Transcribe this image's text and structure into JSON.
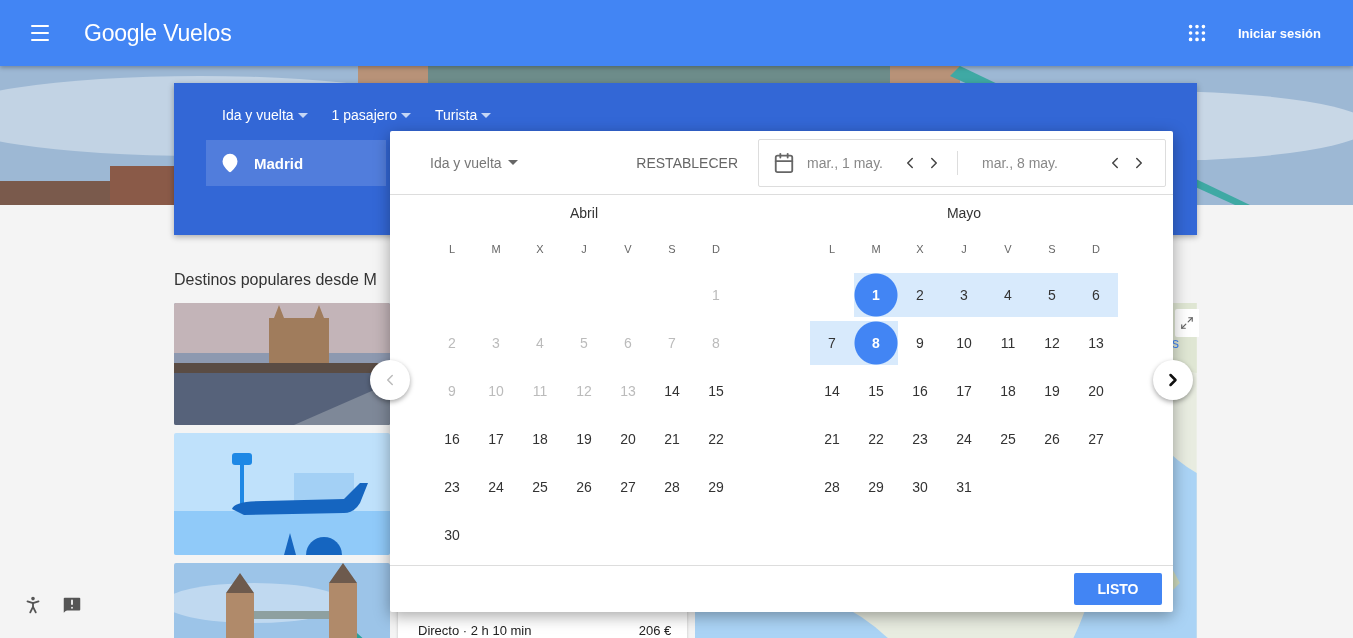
{
  "header": {
    "title": "Google Vuelos",
    "sign_in": "Iniciar sesión"
  },
  "search": {
    "trip_type": "Ida y vuelta",
    "passengers": "1 pasajero",
    "cabin": "Turista",
    "origin": "Madrid"
  },
  "popular": {
    "heading": "Destinos populares desde M",
    "link_fragment": "s",
    "cards": [
      {
        "kind": "picture"
      },
      {
        "kind": "illustration"
      },
      {
        "kind": "picture"
      }
    ],
    "result": {
      "stops": "Directo · 2 h 10 min",
      "price": "206 €"
    }
  },
  "date_picker": {
    "trip_type": "Ida y vuelta",
    "reset": "RESTABLECER",
    "departure": "mar., 1 may.",
    "return": "mar., 8 may.",
    "done": "LISTO",
    "prev_month": {
      "disabled": true
    },
    "next_month": {
      "disabled": false
    },
    "months": [
      {
        "name": "Abril",
        "weekdays": [
          "L",
          "M",
          "X",
          "J",
          "V",
          "S",
          "D"
        ],
        "weeks": [
          [
            {
              "kind": "blank"
            },
            {
              "kind": "blank"
            },
            {
              "kind": "blank"
            },
            {
              "kind": "blank"
            },
            {
              "kind": "blank"
            },
            {
              "kind": "blank"
            },
            {
              "kind": "day",
              "label": "1",
              "disabled": true,
              "selected": false,
              "in_range": false
            }
          ],
          [
            {
              "kind": "day",
              "label": "2",
              "disabled": true,
              "selected": false,
              "in_range": false
            },
            {
              "kind": "day",
              "label": "3",
              "disabled": true,
              "selected": false,
              "in_range": false
            },
            {
              "kind": "day",
              "label": "4",
              "disabled": true,
              "selected": false,
              "in_range": false
            },
            {
              "kind": "day",
              "label": "5",
              "disabled": true,
              "selected": false,
              "in_range": false
            },
            {
              "kind": "day",
              "label": "6",
              "disabled": true,
              "selected": false,
              "in_range": false
            },
            {
              "kind": "day",
              "label": "7",
              "disabled": true,
              "selected": false,
              "in_range": false
            },
            {
              "kind": "day",
              "label": "8",
              "disabled": true,
              "selected": false,
              "in_range": false
            }
          ],
          [
            {
              "kind": "day",
              "label": "9",
              "disabled": true,
              "selected": false,
              "in_range": false
            },
            {
              "kind": "day",
              "label": "10",
              "disabled": true,
              "selected": false,
              "in_range": false
            },
            {
              "kind": "day",
              "label": "11",
              "disabled": true,
              "selected": false,
              "in_range": false
            },
            {
              "kind": "day",
              "label": "12",
              "disabled": true,
              "selected": false,
              "in_range": false
            },
            {
              "kind": "day",
              "label": "13",
              "disabled": true,
              "selected": false,
              "in_range": false
            },
            {
              "kind": "day",
              "label": "14",
              "disabled": false,
              "selected": false,
              "in_range": false
            },
            {
              "kind": "day",
              "label": "15",
              "disabled": false,
              "selected": false,
              "in_range": false
            }
          ],
          [
            {
              "kind": "day",
              "label": "16",
              "disabled": false,
              "selected": false,
              "in_range": false
            },
            {
              "kind": "day",
              "label": "17",
              "disabled": false,
              "selected": false,
              "in_range": false
            },
            {
              "kind": "day",
              "label": "18",
              "disabled": false,
              "selected": false,
              "in_range": false
            },
            {
              "kind": "day",
              "label": "19",
              "disabled": false,
              "selected": false,
              "in_range": false
            },
            {
              "kind": "day",
              "label": "20",
              "disabled": false,
              "selected": false,
              "in_range": false
            },
            {
              "kind": "day",
              "label": "21",
              "disabled": false,
              "selected": false,
              "in_range": false
            },
            {
              "kind": "day",
              "label": "22",
              "disabled": false,
              "selected": false,
              "in_range": false
            }
          ],
          [
            {
              "kind": "day",
              "label": "23",
              "disabled": false,
              "selected": false,
              "in_range": false
            },
            {
              "kind": "day",
              "label": "24",
              "disabled": false,
              "selected": false,
              "in_range": false
            },
            {
              "kind": "day",
              "label": "25",
              "disabled": false,
              "selected": false,
              "in_range": false
            },
            {
              "kind": "day",
              "label": "26",
              "disabled": false,
              "selected": false,
              "in_range": false
            },
            {
              "kind": "day",
              "label": "27",
              "disabled": false,
              "selected": false,
              "in_range": false
            },
            {
              "kind": "day",
              "label": "28",
              "disabled": false,
              "selected": false,
              "in_range": false
            },
            {
              "kind": "day",
              "label": "29",
              "disabled": false,
              "selected": false,
              "in_range": false
            }
          ],
          [
            {
              "kind": "day",
              "label": "30",
              "disabled": false,
              "selected": false,
              "in_range": false
            }
          ]
        ]
      },
      {
        "name": "Mayo",
        "weekdays": [
          "L",
          "M",
          "X",
          "J",
          "V",
          "S",
          "D"
        ],
        "weeks": [
          [
            {
              "kind": "blank"
            },
            {
              "kind": "day",
              "label": "1",
              "disabled": false,
              "selected": true,
              "in_range": true
            },
            {
              "kind": "day",
              "label": "2",
              "disabled": false,
              "selected": false,
              "in_range": true
            },
            {
              "kind": "day",
              "label": "3",
              "disabled": false,
              "selected": false,
              "in_range": true
            },
            {
              "kind": "day",
              "label": "4",
              "disabled": false,
              "selected": false,
              "in_range": true
            },
            {
              "kind": "day",
              "label": "5",
              "disabled": false,
              "selected": false,
              "in_range": true
            },
            {
              "kind": "day",
              "label": "6",
              "disabled": false,
              "selected": false,
              "in_range": true
            }
          ],
          [
            {
              "kind": "day",
              "label": "7",
              "disabled": false,
              "selected": false,
              "in_range": true
            },
            {
              "kind": "day",
              "label": "8",
              "disabled": false,
              "selected": true,
              "in_range": true
            },
            {
              "kind": "day",
              "label": "9",
              "disabled": false,
              "selected": false,
              "in_range": false
            },
            {
              "kind": "day",
              "label": "10",
              "disabled": false,
              "selected": false,
              "in_range": false
            },
            {
              "kind": "day",
              "label": "11",
              "disabled": false,
              "selected": false,
              "in_range": false
            },
            {
              "kind": "day",
              "label": "12",
              "disabled": false,
              "selected": false,
              "in_range": false
            },
            {
              "kind": "day",
              "label": "13",
              "disabled": false,
              "selected": false,
              "in_range": false
            }
          ],
          [
            {
              "kind": "day",
              "label": "14",
              "disabled": false,
              "selected": false,
              "in_range": false
            },
            {
              "kind": "day",
              "label": "15",
              "disabled": false,
              "selected": false,
              "in_range": false
            },
            {
              "kind": "day",
              "label": "16",
              "disabled": false,
              "selected": false,
              "in_range": false
            },
            {
              "kind": "day",
              "label": "17",
              "disabled": false,
              "selected": false,
              "in_range": false
            },
            {
              "kind": "day",
              "label": "18",
              "disabled": false,
              "selected": false,
              "in_range": false
            },
            {
              "kind": "day",
              "label": "19",
              "disabled": false,
              "selected": false,
              "in_range": false
            },
            {
              "kind": "day",
              "label": "20",
              "disabled": false,
              "selected": false,
              "in_range": false
            }
          ],
          [
            {
              "kind": "day",
              "label": "21",
              "disabled": false,
              "selected": false,
              "in_range": false
            },
            {
              "kind": "day",
              "label": "22",
              "disabled": false,
              "selected": false,
              "in_range": false
            },
            {
              "kind": "day",
              "label": "23",
              "disabled": false,
              "selected": false,
              "in_range": false
            },
            {
              "kind": "day",
              "label": "24",
              "disabled": false,
              "selected": false,
              "in_range": false
            },
            {
              "kind": "day",
              "label": "25",
              "disabled": false,
              "selected": false,
              "in_range": false
            },
            {
              "kind": "day",
              "label": "26",
              "disabled": false,
              "selected": false,
              "in_range": false
            },
            {
              "kind": "day",
              "label": "27",
              "disabled": false,
              "selected": false,
              "in_range": false
            }
          ],
          [
            {
              "kind": "day",
              "label": "28",
              "disabled": false,
              "selected": false,
              "in_range": false
            },
            {
              "kind": "day",
              "label": "29",
              "disabled": false,
              "selected": false,
              "in_range": false
            },
            {
              "kind": "day",
              "label": "30",
              "disabled": false,
              "selected": false,
              "in_range": false
            },
            {
              "kind": "day",
              "label": "31",
              "disabled": false,
              "selected": false,
              "in_range": false
            }
          ]
        ]
      }
    ]
  }
}
